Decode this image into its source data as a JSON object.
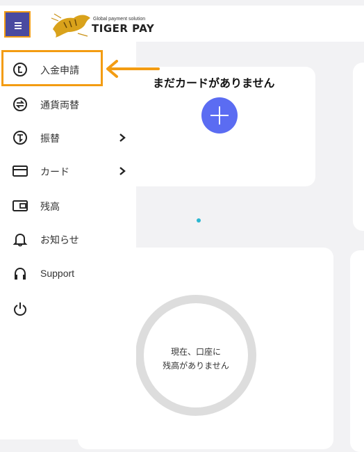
{
  "header": {
    "logo_tagline": "Global payment solution",
    "logo_name": "TIGER PAY"
  },
  "sidebar": {
    "items": [
      {
        "label": "入金申請",
        "icon": "deposit-icon",
        "has_submenu": false,
        "highlighted": true
      },
      {
        "label": "通貨両替",
        "icon": "exchange-icon",
        "has_submenu": false
      },
      {
        "label": "振替",
        "icon": "transfer-icon",
        "has_submenu": true
      },
      {
        "label": "カード",
        "icon": "card-icon",
        "has_submenu": true
      },
      {
        "label": "残高",
        "icon": "wallet-icon",
        "has_submenu": false
      },
      {
        "label": "お知らせ",
        "icon": "bell-icon",
        "has_submenu": false
      },
      {
        "label": "Support",
        "icon": "headset-icon",
        "has_submenu": false
      },
      {
        "label": "",
        "icon": "power-icon",
        "has_submenu": false
      }
    ]
  },
  "main": {
    "card_panel": {
      "title": "まだカードがありません"
    },
    "balance_panel": {
      "message_line1": "現在、口座に",
      "message_line2": "残高がありません"
    }
  },
  "colors": {
    "accent_orange": "#f39c12",
    "menu_button": "#4a4aa0",
    "add_button": "#5b6cf2",
    "carousel_dot": "#2bb7d1"
  }
}
